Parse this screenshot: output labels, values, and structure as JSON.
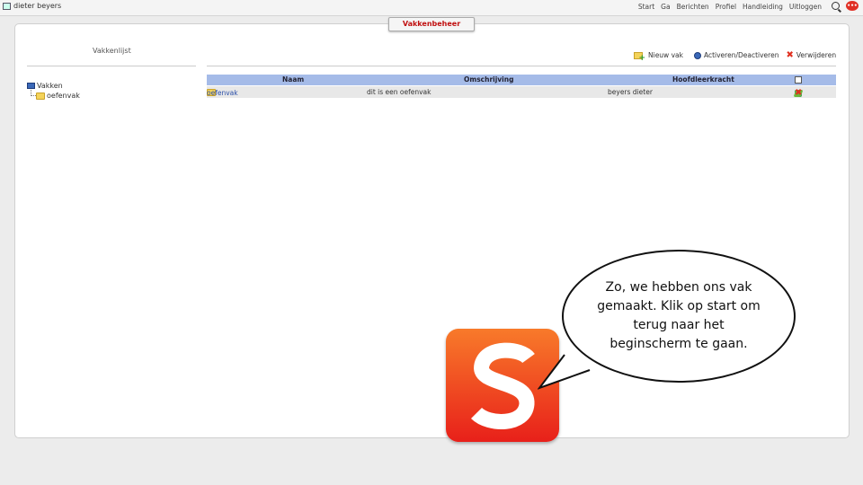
{
  "header": {
    "user_name": "dieter beyers",
    "nav": [
      "Start",
      "Ga",
      "Berichten",
      "Profiel",
      "Handleiding",
      "Uitloggen"
    ],
    "chat_badge": "•••"
  },
  "page_tab": "Vakkenbeheer",
  "sidebar": {
    "title": "Vakkenlijst",
    "tree": {
      "root": "Vakken",
      "child": "oefenvak"
    }
  },
  "toolbar": {
    "new_label": "Nieuw vak",
    "toggle_label": "Activeren/Deactiveren",
    "delete_label": "Verwijderen"
  },
  "table": {
    "columns": [
      "Naam",
      "Omschrijving",
      "Hoofdleerkracht"
    ],
    "rows": [
      {
        "name": "oefenvak",
        "description": "dit is een oefenvak",
        "teacher": "beyers dieter"
      }
    ]
  },
  "bubble": {
    "text": "Zo, we hebben ons vak gemaakt. Klik op start om terug naar het beginscherm te gaan."
  },
  "colors": {
    "accent_red": "#e03020",
    "table_header": "#a5bbe8",
    "logo_top": "#f87a2a",
    "logo_bottom": "#e8201a"
  }
}
